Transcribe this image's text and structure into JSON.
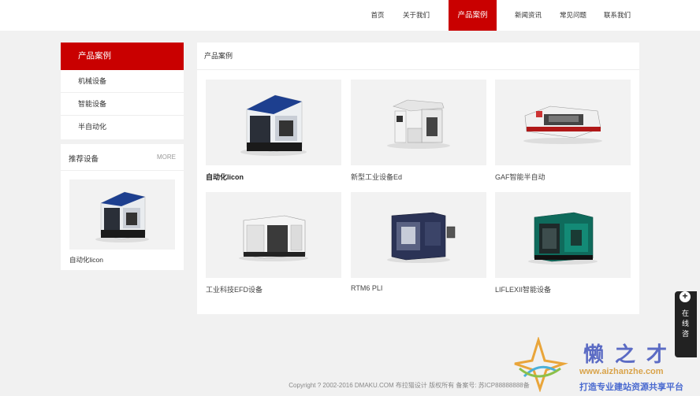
{
  "nav": {
    "items": [
      "首页",
      "关于我们",
      "产品案例",
      "新闻资讯",
      "常见问题",
      "联系我们"
    ],
    "active_index": 2
  },
  "sidebar": {
    "heading": "产品案例",
    "items": [
      "机械设备",
      "智能设备",
      "半自动化"
    ]
  },
  "recommend": {
    "title": "推荐设备",
    "more": "MORE",
    "item_caption": "自动化licon"
  },
  "main": {
    "heading": "产品案例",
    "products": [
      {
        "caption": "自动化licon",
        "icon": "machine-blue-white"
      },
      {
        "caption": "新型工业设备Ed",
        "icon": "machine-open-frame"
      },
      {
        "caption": "GAF智能半自动",
        "icon": "machine-laser-cutter"
      },
      {
        "caption": "工业科技EFD设备",
        "icon": "machine-white-cabinet"
      },
      {
        "caption": "RTM6 PLI",
        "icon": "machine-navy-cnc"
      },
      {
        "caption": "LIFLEXII智能设备",
        "icon": "machine-green-cnc"
      }
    ]
  },
  "footer": {
    "text": "Copyright ? 2002-2016 DMAKU.COM 布拉猫设计 版权所有 备案号: 苏ICP88888888备"
  },
  "online": {
    "text": "在线咨"
  },
  "watermark": {
    "big": "懒之才",
    "url": "www.aizhanzhe.com",
    "slogan": "打造专业建站资源共享平台"
  },
  "colors": {
    "accent": "#c90000",
    "background": "#f1f1f1"
  }
}
